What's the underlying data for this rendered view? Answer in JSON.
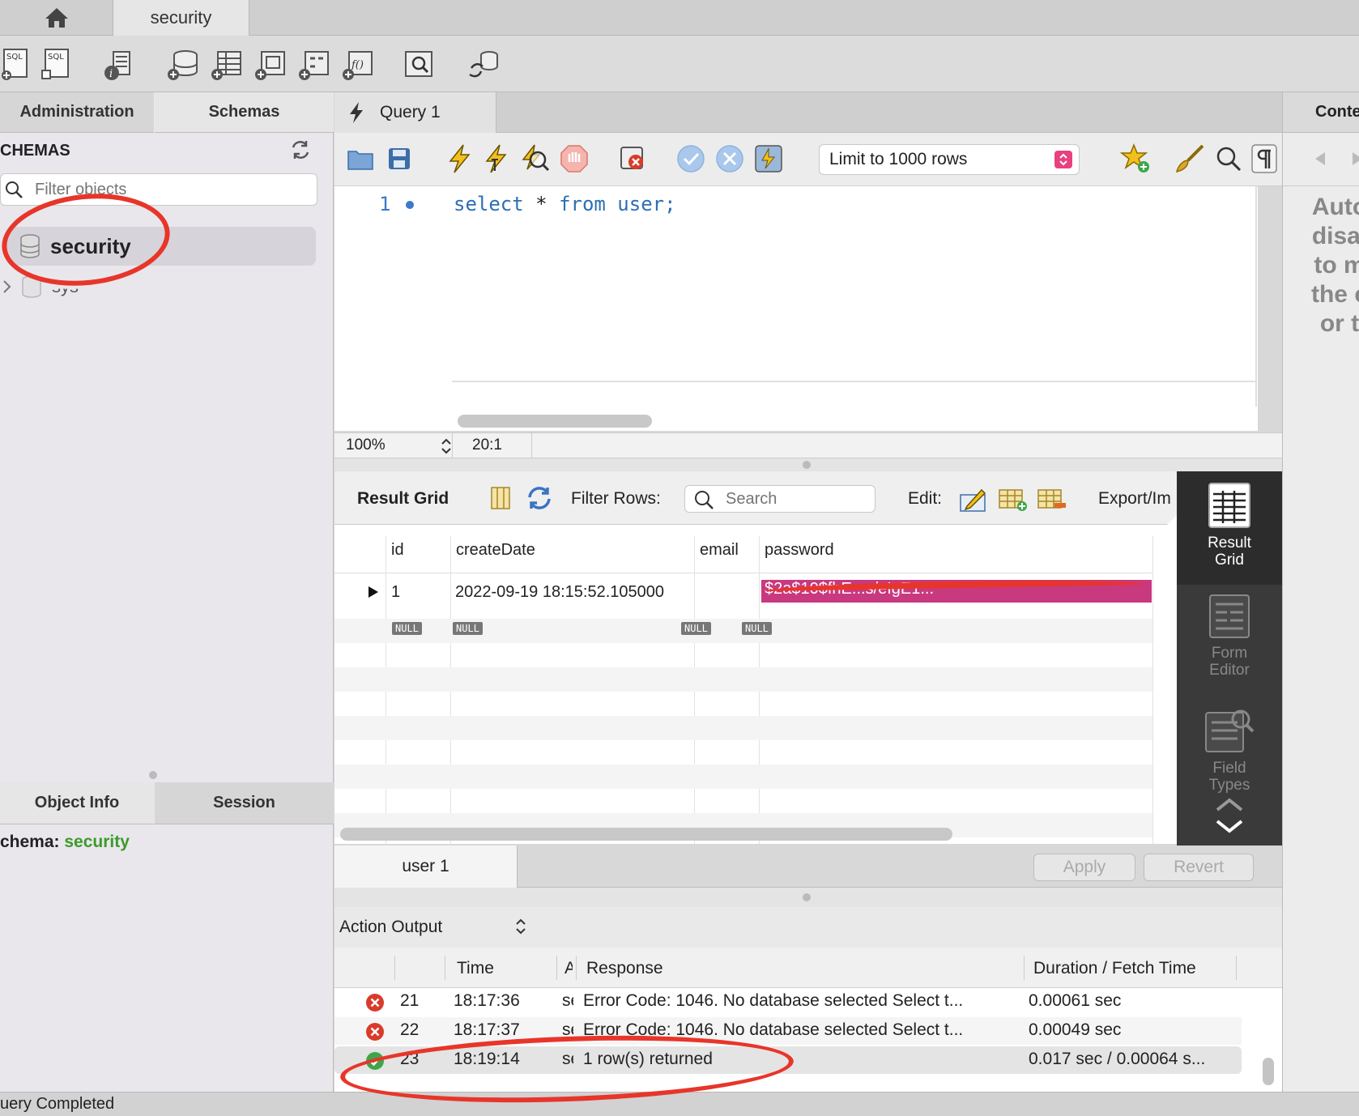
{
  "connection_tab": {
    "label": "security"
  },
  "sidebar": {
    "tabs": [
      "Administration",
      "Schemas"
    ],
    "schemas_header": "CHEMAS",
    "filter_placeholder": "Filter objects",
    "schemas": [
      {
        "name": "security",
        "selected": true
      },
      {
        "name": "sys",
        "partial_label": "sys"
      }
    ],
    "info_tabs": [
      "Object Info",
      "Session"
    ],
    "schema_info_label": "chema:",
    "schema_info_value": "security"
  },
  "query_tab": {
    "label": "Query 1"
  },
  "query_toolbar": {
    "limit_label": "Limit to 1000 rows"
  },
  "editor": {
    "line_number": "1",
    "code": {
      "kw1": "select",
      "op": " * ",
      "kw2": "from",
      "rest": " user;"
    },
    "zoom": "100%",
    "cursor": "20:1"
  },
  "result_bar": {
    "title": "Result Grid",
    "filter_label": "Filter Rows:",
    "search_placeholder": "Search",
    "edit_label": "Edit:",
    "export_label": "Export/Im"
  },
  "grid": {
    "columns": [
      "id",
      "createDate",
      "email",
      "password"
    ],
    "row": {
      "id": "1",
      "createDate": "2022-09-19 18:15:52.105000",
      "email": "",
      "password": "$2a$10$fhE...s/eIgE1..."
    },
    "null_label": "NULL"
  },
  "right_panel": {
    "items": [
      {
        "label_line1": "Result",
        "label_line2": "Grid",
        "active": true
      },
      {
        "label_line1": "Form",
        "label_line2": "Editor",
        "active": false
      },
      {
        "label_line1": "Field",
        "label_line2": "Types",
        "active": false
      }
    ]
  },
  "result_tabs": {
    "tab_label": "user 1",
    "apply_label": "Apply",
    "revert_label": "Revert"
  },
  "action_output": {
    "title": "Action Output",
    "columns": {
      "time": "Time",
      "action": "A",
      "response": "Response",
      "duration": "Duration / Fetch Time"
    },
    "rows": [
      {
        "status": "error",
        "num": "21",
        "time": "18:17:36",
        "action": "se",
        "response": "Error Code: 1046. No database selected Select t...",
        "duration": "0.00061 sec"
      },
      {
        "status": "error",
        "num": "22",
        "time": "18:17:37",
        "action": "se",
        "response": "Error Code: 1046. No database selected Select t...",
        "duration": "0.00049 sec"
      },
      {
        "status": "ok",
        "num": "23",
        "time": "18:19:14",
        "action": "se",
        "response": "1 row(s) returned",
        "duration": "0.017 sec / 0.00064 s..."
      }
    ]
  },
  "right_sidebar": {
    "tab_label": "Conte",
    "text_lines": [
      "Auto",
      "disal",
      "to m",
      "the c",
      "or t"
    ]
  },
  "statusbar": {
    "text": "uery Completed"
  },
  "colors": {
    "accent_blue": "#2c6fb3",
    "highlight_pink": "#c8397f",
    "annotation_red": "#e8352a",
    "schema_green": "#3c9a2a"
  }
}
